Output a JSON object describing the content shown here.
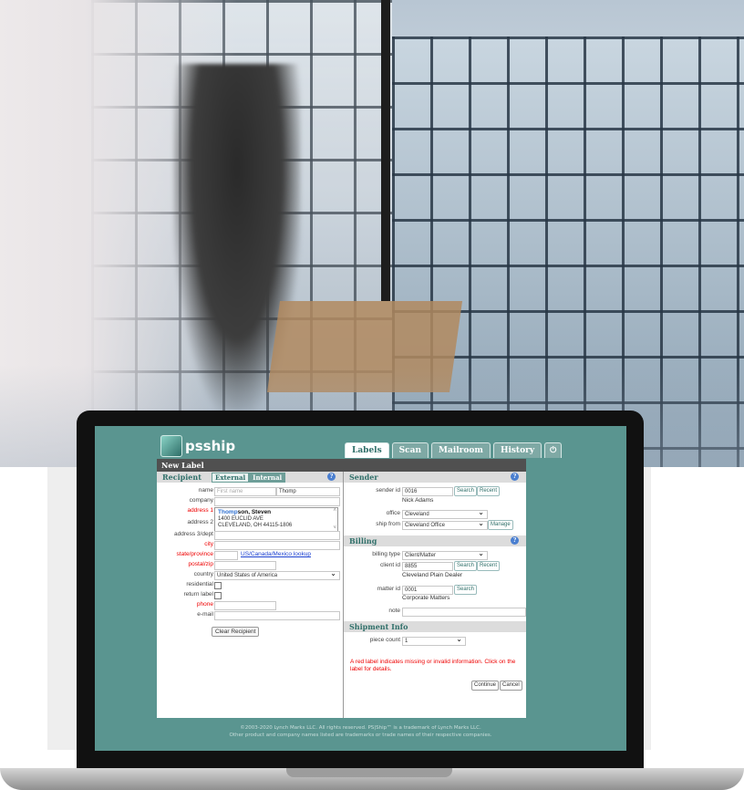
{
  "app": {
    "brand": "psship",
    "window_title": "New Label"
  },
  "tabs": [
    {
      "label": "Labels",
      "active": true
    },
    {
      "label": "Scan",
      "active": false
    },
    {
      "label": "Mailroom",
      "active": false
    },
    {
      "label": "History",
      "active": false
    },
    {
      "label": "",
      "icon": "power-icon",
      "active": false
    }
  ],
  "recipient": {
    "heading": "Recipient",
    "toggle": [
      "External",
      "Internal"
    ],
    "fields": {
      "name_label": "name",
      "name_first_placeholder": "First name",
      "name_last_value": "Thomp",
      "company_label": "company",
      "address1_label": "address 1",
      "address2_label": "address 2",
      "address3_label": "address 3/dept",
      "suggestion_match": "Thomp",
      "suggestion_name_rest": "son, Steven",
      "suggestion_line2": "1400 EUCLID AVE",
      "suggestion_line3": "CLEVELAND, OH 44115-1806",
      "city_label": "city",
      "state_label": "state/province",
      "state_link": "US/Canada/Mexico lookup",
      "postal_label": "postal/zip",
      "country_label": "country",
      "country_value": "United States of America",
      "residential_label": "residential",
      "return_label": "return label",
      "phone_label": "phone",
      "email_label": "e-mail"
    },
    "clear_button": "Clear Recipient"
  },
  "sender": {
    "heading": "Sender",
    "sender_id_label": "sender id",
    "sender_id_value": "0016",
    "search": "Search",
    "recent": "Recent",
    "sender_name": "Nick Adams",
    "office_label": "office",
    "office_value": "Cleveland",
    "ship_from_label": "ship from",
    "ship_from_value": "Cleveland Office",
    "manage": "Manage"
  },
  "billing": {
    "heading": "Billing",
    "billing_type_label": "billing type",
    "billing_type_value": "Client/Matter",
    "client_id_label": "client id",
    "client_id_value": "8855",
    "client_name": "Cleveland Plain Dealer",
    "matter_id_label": "matter id",
    "matter_id_value": "0001",
    "matter_name": "Corporate Matters",
    "note_label": "note"
  },
  "shipment": {
    "heading": "Shipment Info",
    "piece_count_label": "piece count",
    "piece_count_value": "1",
    "warning": "A red label indicates missing or invalid information. Click on the label for details.",
    "continue": "Continue",
    "cancel": "Cancel"
  },
  "footer": {
    "line1": "©2003-2020 Lynch Marks LLC. All rights reserved. PS|Ship™ is a trademark of Lynch Marks LLC.",
    "line2": "Other product and company names listed are trademarks or trade names of their respective companies."
  },
  "colors": {
    "screen_bg": "#5a9590",
    "accent": "#2f6f69",
    "required": "#ee0000",
    "help": "#4a7fd0"
  }
}
